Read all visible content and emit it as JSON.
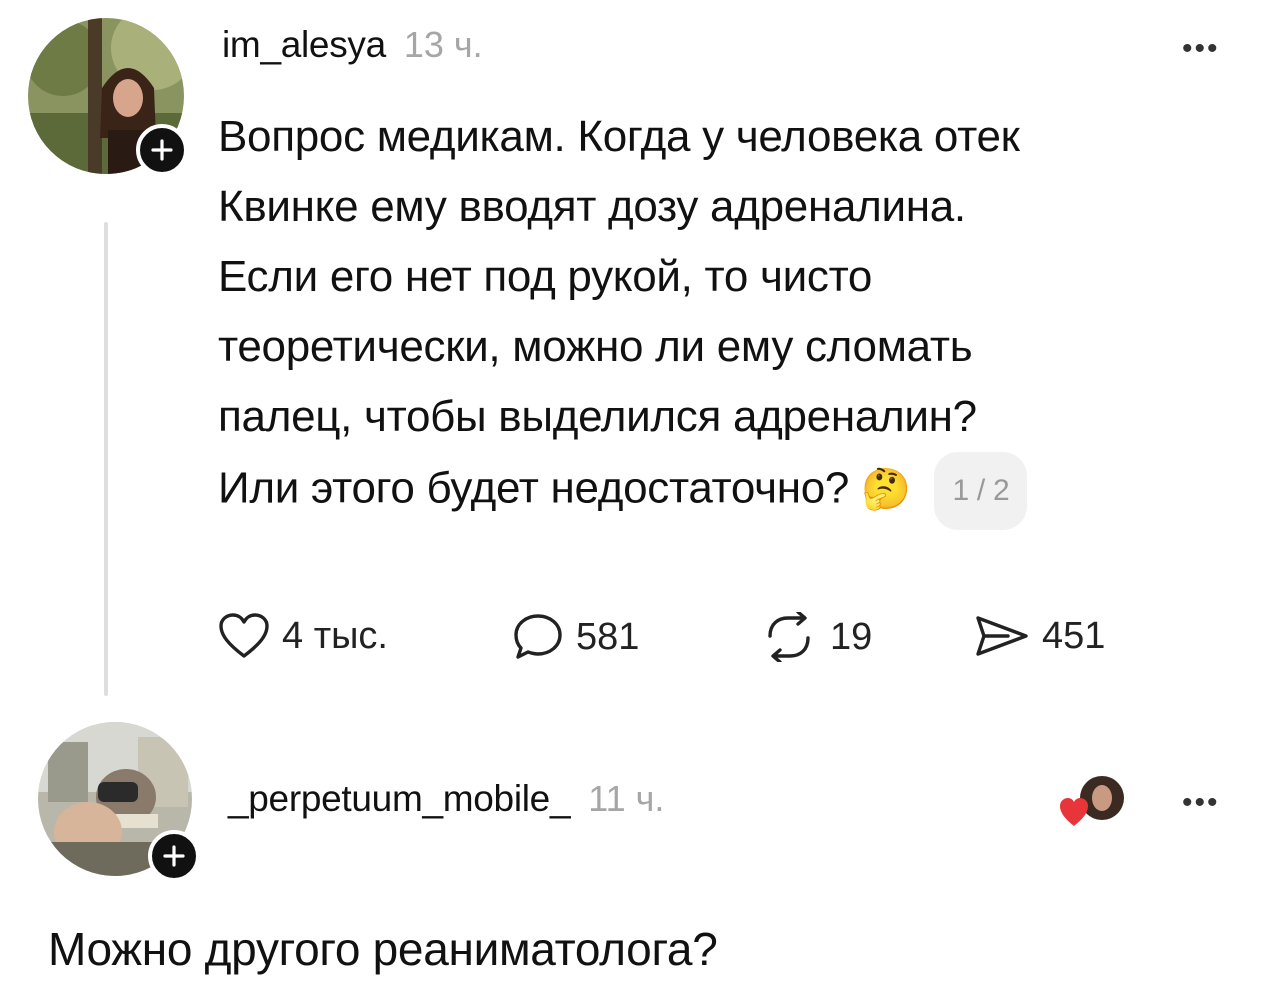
{
  "post": {
    "username": "im_alesya",
    "time": "13 ч.",
    "more_label": "•••",
    "lines": [
      "Вопрос медикам. Когда у человека отек",
      "Квинке ему вводят дозу адреналина.",
      "Если его нет под рукой, то чисто",
      "теоретически, можно ли ему сломать",
      "палец, чтобы выделился адреналин?",
      "Или этого будет недостаточно?"
    ],
    "emoji": "🤔",
    "page_indicator": "1 / 2",
    "actions": {
      "likes": "4 тыс.",
      "comments": "581",
      "reposts": "19",
      "shares": "451"
    }
  },
  "reply": {
    "username": "_perpetuum_mobile_",
    "time": "11 ч.",
    "more_label": "•••",
    "text": "Можно другого реаниматолога?"
  }
}
